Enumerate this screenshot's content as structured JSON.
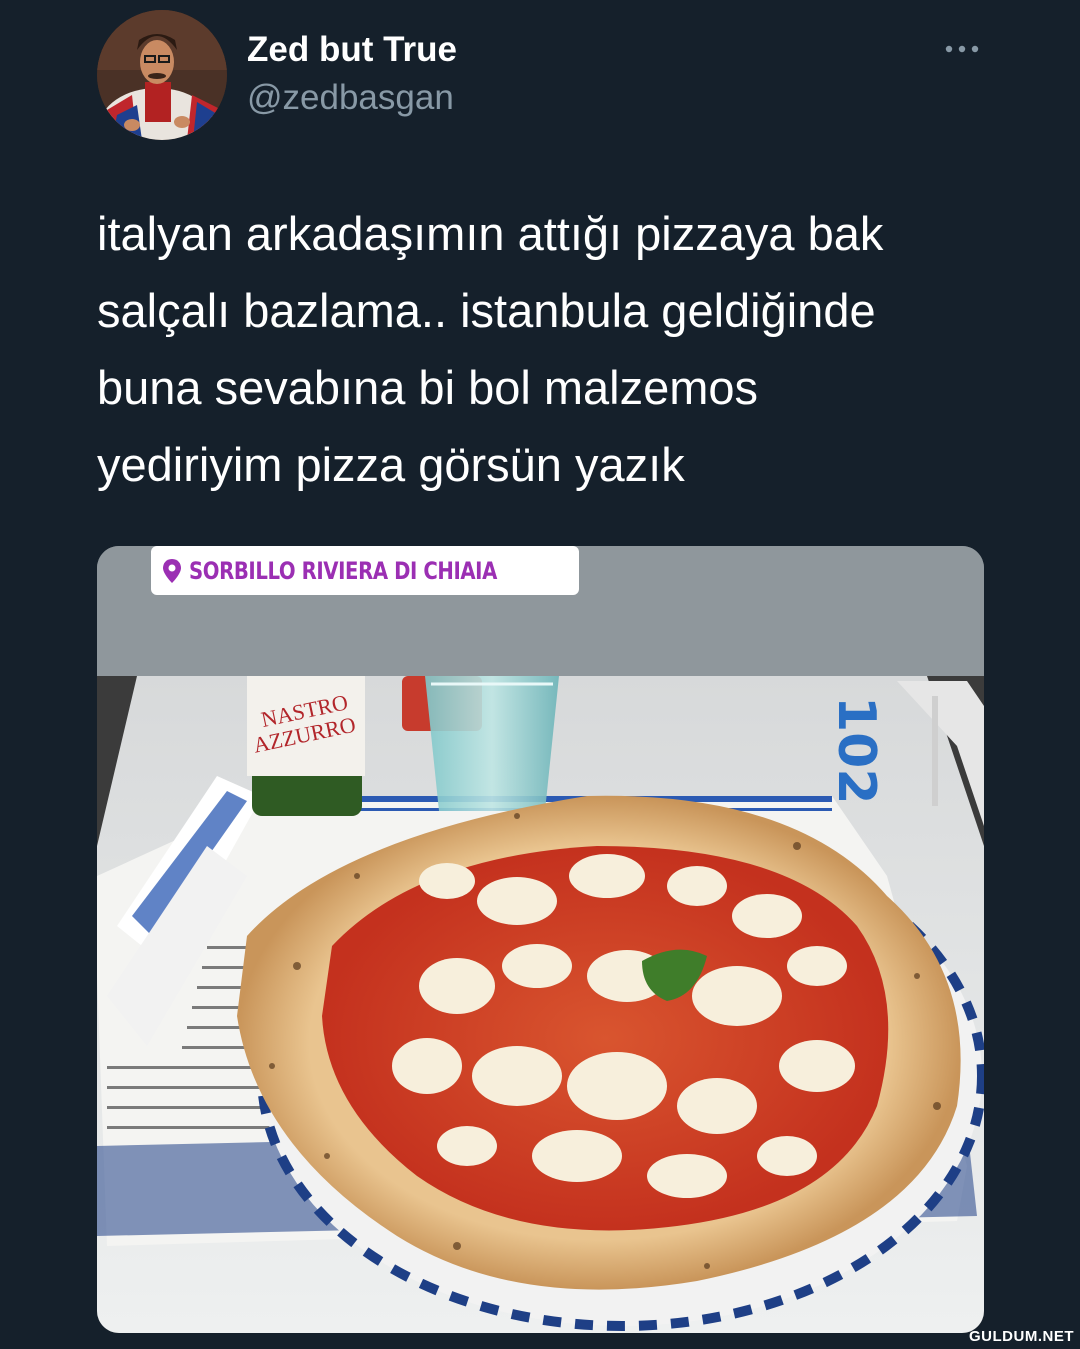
{
  "tweet": {
    "author": {
      "display_name": "Zed but True",
      "handle": "@zedbasgan"
    },
    "more_icon": "more-horizontal-icon",
    "text": "italyan arkadaşımın attığı pizzaya bak\nsalçalı bazlama.. istanbula geldiğinde\nbuna sevabına bi bol malzemos\nyediriyim pizza görsün yazık",
    "media": {
      "location_sticker": {
        "icon": "location-pin-icon",
        "text": "SORBILLO RIVIERA DI CHIAIA"
      },
      "bottle_label_text": "NASTRO\nAZZURRO",
      "table_number": "102"
    }
  },
  "watermark": "GULDUM.NET",
  "colors": {
    "background": "#15202b",
    "text_primary": "#ffffff",
    "text_secondary": "#8899a6",
    "sticker_text": "#9b2fb3"
  }
}
